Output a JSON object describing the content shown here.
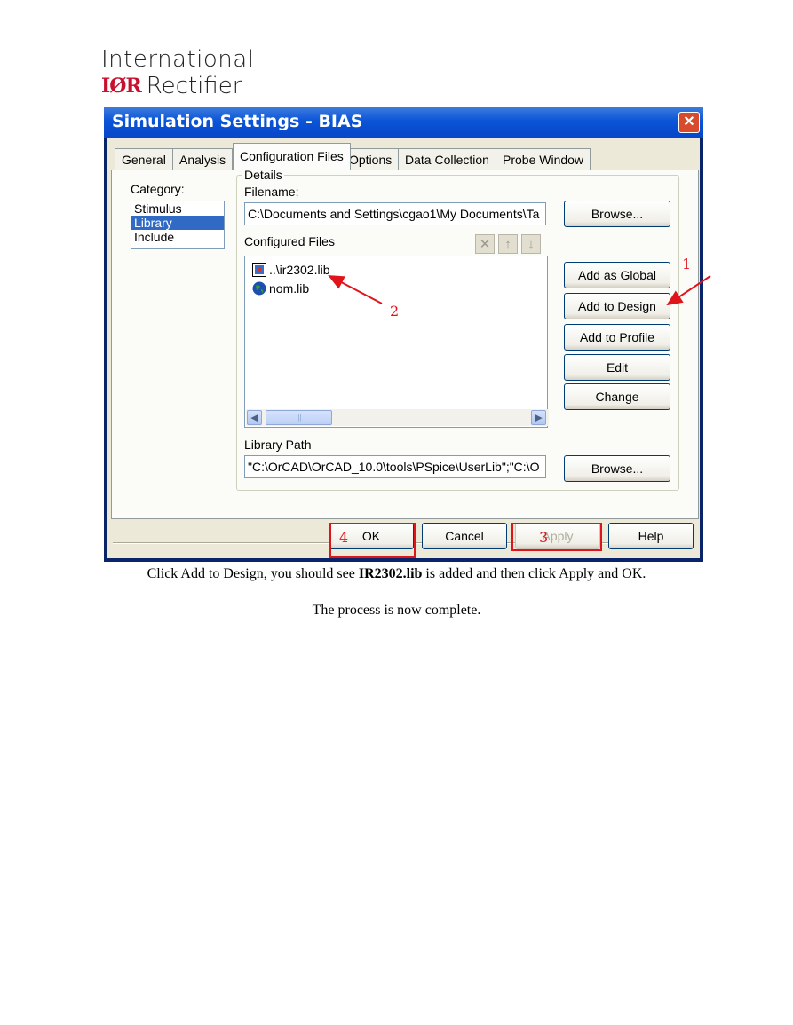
{
  "logo": {
    "line1": "International",
    "brand": "IØR",
    "line2": "Rectifier"
  },
  "window": {
    "title": "Simulation Settings - BIAS",
    "close": "✕"
  },
  "tabs": [
    "General",
    "Analysis",
    "Configuration Files",
    "Options",
    "Data Collection",
    "Probe Window"
  ],
  "active_tab": "Configuration Files",
  "category": {
    "label": "Category:",
    "items": [
      "Stimulus",
      "Library",
      "Include"
    ],
    "selected": "Library"
  },
  "details": {
    "group_label": "Details",
    "filename_label": "Filename:",
    "filename_value": "C:\\Documents and Settings\\cgao1\\My Documents\\Ta",
    "browse1": "Browse...",
    "configured_label": "Configured Files",
    "configured_files": [
      "..\\ir2302.lib",
      "nom.lib"
    ],
    "library_path_label": "Library Path",
    "library_path_value": "\"C:\\OrCAD\\OrCAD_10.0\\tools\\PSpice\\UserLib\";\"C:\\O",
    "browse2": "Browse..."
  },
  "side_buttons": [
    "Add as Global",
    "Add to Design",
    "Add to Profile",
    "Edit",
    "Change"
  ],
  "bottom_buttons": {
    "ok": "OK",
    "cancel": "Cancel",
    "apply": "Apply",
    "help": "Help"
  },
  "annotations": {
    "n1": "1",
    "n2": "2",
    "n3": "3",
    "n4": "4",
    "color": "#e0141b"
  },
  "caption": {
    "before": "Click Add to Design, you should see ",
    "bold": "IR2302.lib",
    "after": " is added and then click Apply and OK.",
    "line2": "The process is now complete."
  }
}
